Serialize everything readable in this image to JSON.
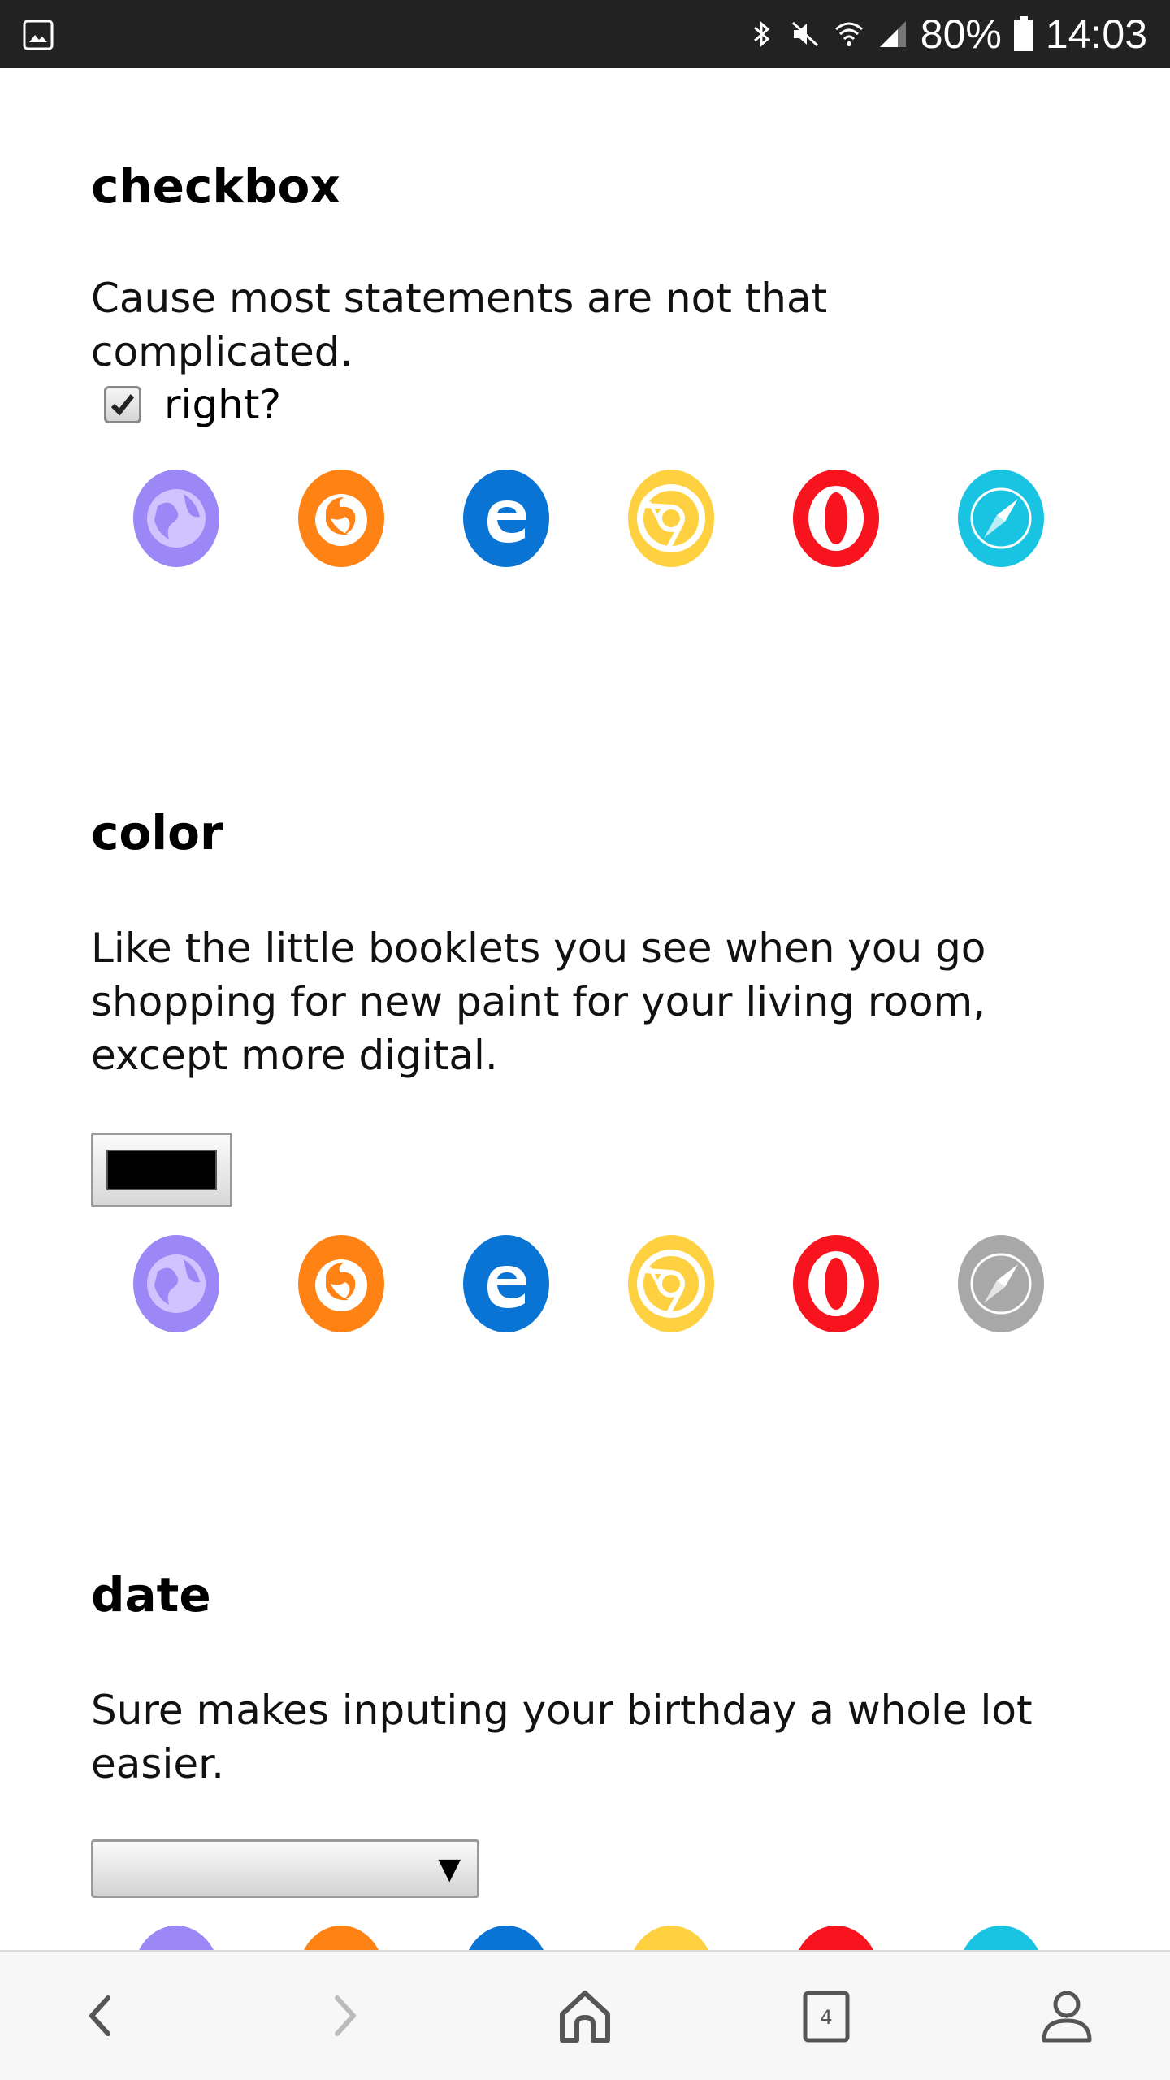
{
  "status_bar": {
    "battery": "80%",
    "time": "14:03",
    "icons": [
      "gallery-icon",
      "bluetooth-icon",
      "mute-icon",
      "wifi-icon",
      "signal-icon",
      "battery-icon"
    ]
  },
  "sections": [
    {
      "title": "checkbox",
      "description": "Cause most statements are not that complicated.",
      "checkbox_label": "right?",
      "checkbox_checked": true
    },
    {
      "title": "color",
      "description_lines": [
        "Like the little booklets you see when you go",
        "shopping for new paint for your living room,",
        "except more digital."
      ],
      "color_value": "#000000"
    },
    {
      "title": "date",
      "description_lines": [
        "Sure makes inputing your birthday a whole lot",
        "easier."
      ],
      "date_value": ""
    }
  ],
  "browser_icons": [
    "web-browser-icon",
    "firefox-icon",
    "edge-icon",
    "chrome-icon",
    "opera-icon",
    "safari-icon"
  ],
  "browser_colors": {
    "web": "#9b87f5",
    "firefox": "#ff8214",
    "edge": "#0a74d5",
    "chrome": "#ffd140",
    "opera": "#f8141e",
    "safari": "#18c4e2",
    "unsupported": "#a8a8a8"
  },
  "bottom_nav": {
    "tab_count": "4",
    "items": [
      "back-icon",
      "forward-icon",
      "home-icon",
      "tabs-icon",
      "account-icon"
    ]
  }
}
